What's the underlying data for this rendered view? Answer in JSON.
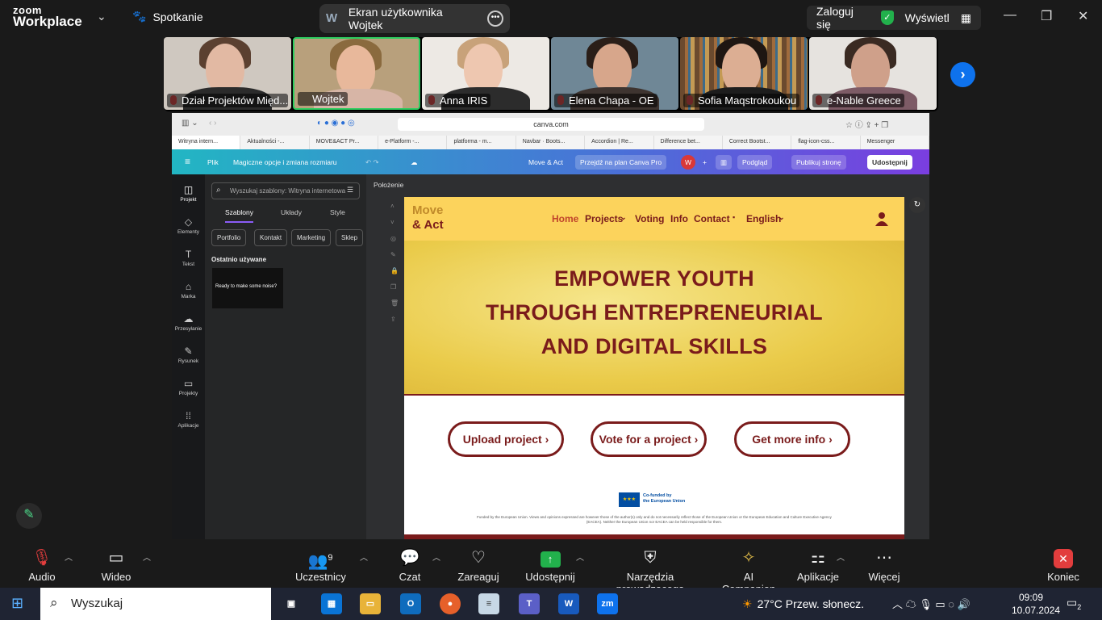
{
  "app": {
    "brand_line1": "zoom",
    "brand_line2": "Workplace",
    "meeting_label": "Spotkanie"
  },
  "share_pill": {
    "badge": "W",
    "title": "Ekran użytkownika Wojtek"
  },
  "top_right": {
    "login": "Zaloguj się",
    "view": "Wyświetl"
  },
  "participants": [
    {
      "name": "Dział Projektów Międ..."
    },
    {
      "name": "Wojtek"
    },
    {
      "name": "Anna IRIS"
    },
    {
      "name": "Elena Chapa - OE"
    },
    {
      "name": "Sofia Maqstrokoukou"
    },
    {
      "name": "e-Nable Greece"
    }
  ],
  "browser": {
    "url": "canva.com",
    "bookmarks": [
      "Witryna intern...",
      "Aktualności -...",
      "MOVE&ACT Pr...",
      "e-Platform -...",
      "platforma - m...",
      "Navbar · Boots...",
      "Accordion | Re...",
      "Difference bet...",
      "Correct Bootst...",
      "flag-icon-css...",
      "Messenger"
    ]
  },
  "canva": {
    "menu_file": "Plik",
    "magic": "Magiczne opcje i zmiana rozmiaru",
    "doc_title": "Move & Act",
    "pro": "Przejdź na plan Canva Pro",
    "avatar": "W",
    "preview": "Podgląd",
    "publish": "Publikuj stronę",
    "share": "Udostępnij",
    "sidebar": [
      "Projekt",
      "Elementy",
      "Tekst",
      "Marka",
      "Przesyłanie",
      "Rysunek",
      "Projekty",
      "Aplikacje"
    ],
    "search_placeholder": "Wyszukaj szablony: Witryna internetowa",
    "panel_tabs": [
      "Szablony",
      "Układy",
      "Style"
    ],
    "chips": [
      "Portfolio",
      "Kontakt",
      "Marketing",
      "Sklep"
    ],
    "recent_label": "Ostatnio używane",
    "thumb_text": "Ready to make some noise?",
    "position_label": "Położenie"
  },
  "site": {
    "logo_top": "Move",
    "logo_bottom": "& Act",
    "nav": [
      "Home",
      "Projects",
      "Voting",
      "Info",
      "Contact",
      "English"
    ],
    "hero": [
      "EMPOWER YOUTH",
      "THROUGH ENTREPRENEURIAL",
      "AND DIGITAL SKILLS"
    ],
    "ctas": [
      "Upload project",
      "Vote for a project",
      "Get more info"
    ],
    "eu_line1": "Co-funded by",
    "eu_line2": "the European Union",
    "disclaimer": "Funded by the European Union. Views and opinions expressed are however those of the author(s) only and do not necessarily reflect those of the European Union or the European Education and Culture Executive Agency (EACEA). Neither the European Union nor EACEA can be held responsible for them."
  },
  "toolbar": {
    "audio": "Audio",
    "video": "Wideo",
    "participants": "Uczestnicy",
    "participants_count": "9",
    "chat": "Czat",
    "react": "Zareaguj",
    "share": "Udostępnij",
    "host_tools": "Narzędzia prowadzącego",
    "ai": "AI Companion",
    "apps": "Aplikacje",
    "more": "Więcej",
    "end": "Koniec"
  },
  "taskbar": {
    "search": "Wyszukaj",
    "weather": "27°C  Przew. słonecz.",
    "time": "09:09",
    "date": "10.07.2024",
    "notifications": "2"
  },
  "colors": {
    "accent": "#0e72ed",
    "site_maroon": "#7a1b1b",
    "site_yellow": "#fcd35c",
    "share_green": "#22b14c",
    "end_red": "#e23d3d"
  }
}
